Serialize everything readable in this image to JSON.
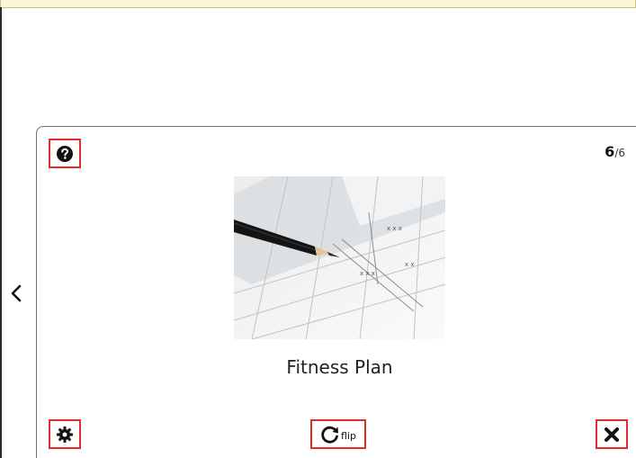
{
  "card": {
    "title": "Fitness Plan",
    "image_icon": "drafting-pencil-blueprint-image"
  },
  "counter": {
    "current": "6",
    "separator": "/",
    "total": "6"
  },
  "toolbar": {
    "help_icon": "question-circle-icon",
    "settings_icon": "gear-icon",
    "flip_icon": "rotate-icon",
    "flip_label": "flip",
    "close_icon": "close-icon",
    "prev_icon": "chevron-left-icon"
  },
  "colors": {
    "highlight_border": "#e22b2b",
    "top_bar_bg": "#fbf6d6",
    "card_border": "#6f6f6f"
  }
}
